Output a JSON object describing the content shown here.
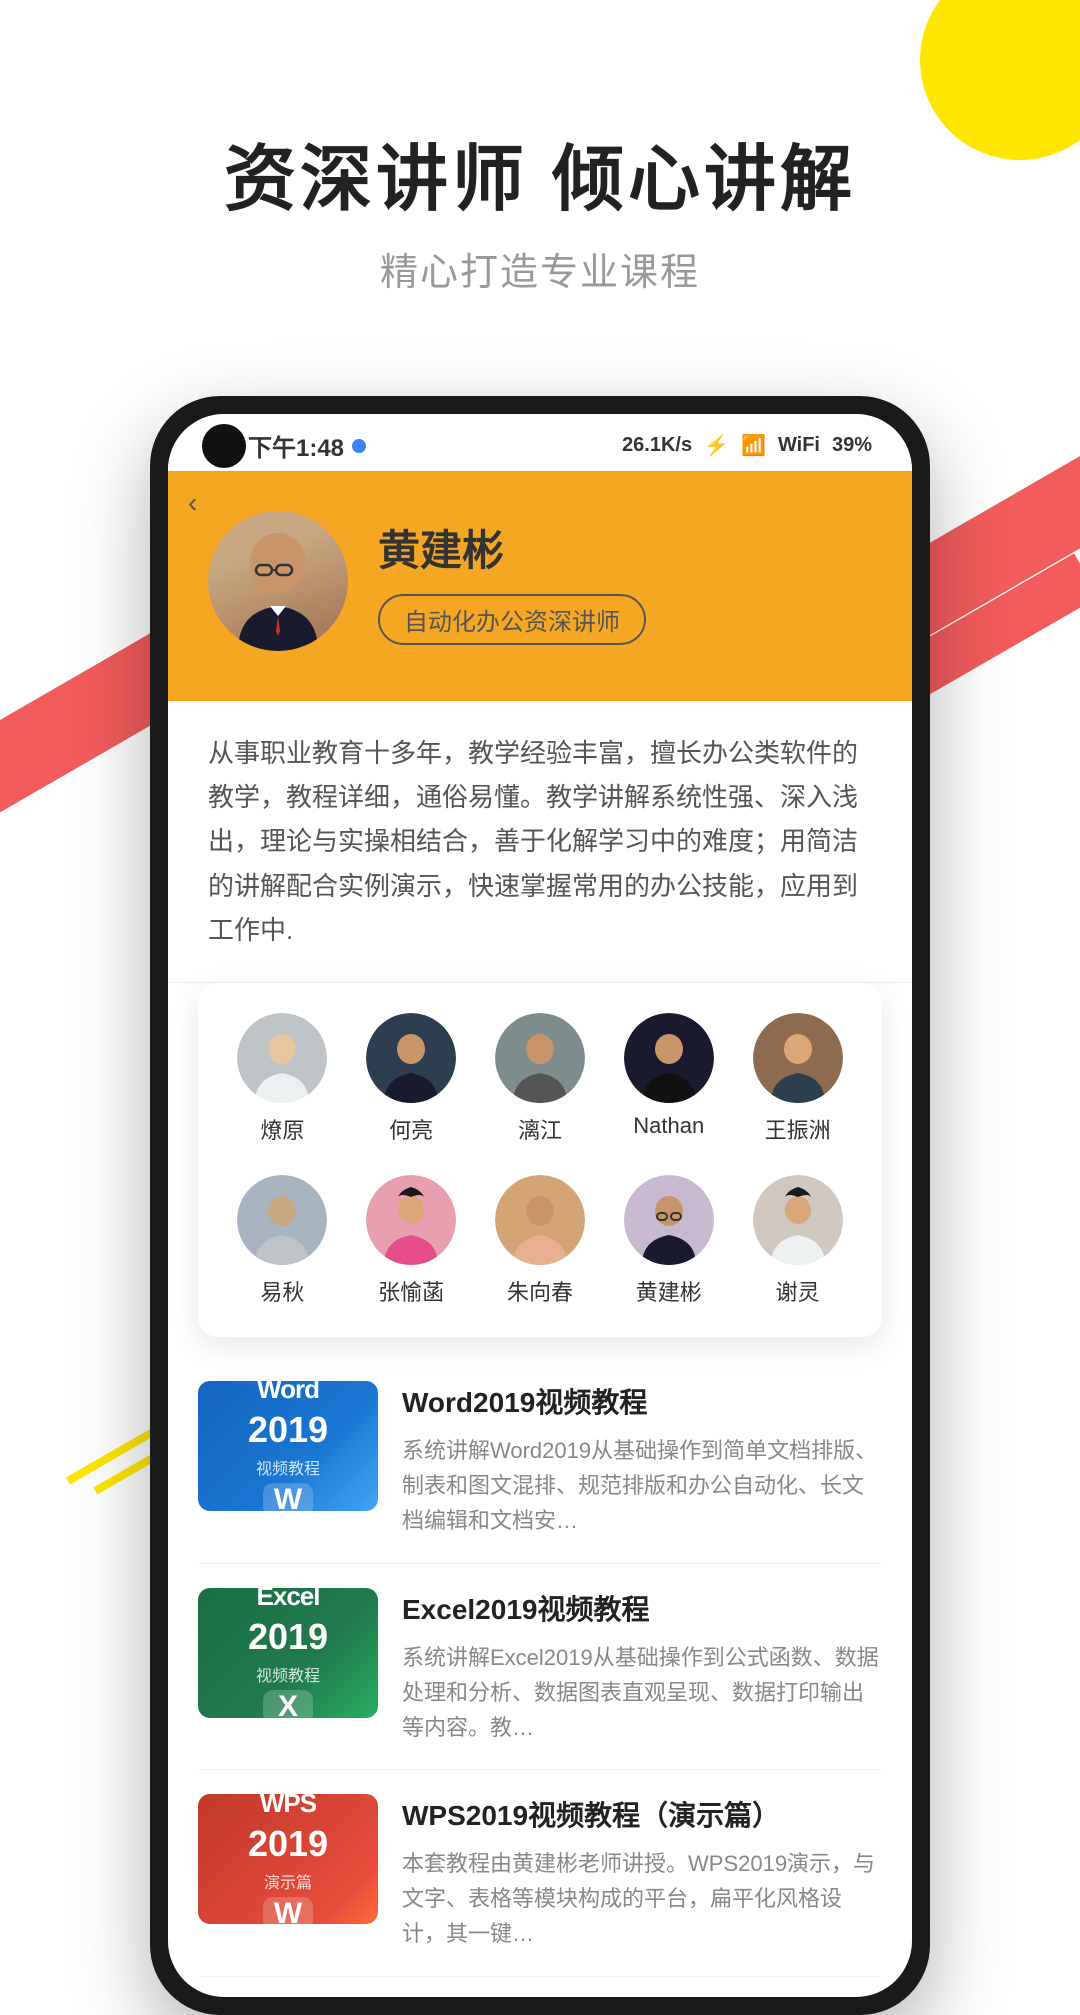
{
  "decorations": {
    "circle_color": "#FFE600",
    "stripe_color": "#F04040"
  },
  "header": {
    "title": "资深讲师  倾心讲解",
    "subtitle": "精心打造专业课程"
  },
  "phone": {
    "status": {
      "time": "下午1:48",
      "network_speed": "26.1K/s",
      "battery": "39%"
    },
    "instructor_profile": {
      "back_label": "‹",
      "name": "黄建彬",
      "badge": "自动化办公资深讲师",
      "bio": "从事职业教育十多年，教学经验丰富，擅长办公类软件的教学，教程详细，通俗易懂。教学讲解系统性强、深入浅出，理论与实操相结合，善于化解学习中的难度；用简洁的讲解配合实例演示，快速掌握常用的办公技能，应用到工作中."
    },
    "instructor_grid": {
      "row1": [
        {
          "name": "燎原",
          "avatar_class": "av-1"
        },
        {
          "name": "何亮",
          "avatar_class": "av-2"
        },
        {
          "name": "漓江",
          "avatar_class": "av-3"
        },
        {
          "name": "Nathan",
          "avatar_class": "av-4"
        },
        {
          "name": "王振洲",
          "avatar_class": "av-5"
        }
      ],
      "row2": [
        {
          "name": "易秋",
          "avatar_class": "av-6"
        },
        {
          "name": "张愉菡",
          "avatar_class": "av-7"
        },
        {
          "name": "朱向春",
          "avatar_class": "av-8"
        },
        {
          "name": "黄建彬",
          "avatar_class": "av-9"
        },
        {
          "name": "谢灵",
          "avatar_class": "av-10"
        }
      ]
    },
    "courses": [
      {
        "id": "word2019",
        "thumb_type": "word",
        "title": "Word2019视频教程",
        "desc": "系统讲解Word2019从基础操作到简单文档排版、制表和图文混排、规范排版和办公自动化、长文档编辑和文档安…",
        "thumb_label_big": "Word",
        "thumb_label_year": "2019",
        "thumb_label_sub": "视频教程",
        "word_letter": "W"
      },
      {
        "id": "excel2019",
        "thumb_type": "excel",
        "title": "Excel2019视频教程",
        "desc": "系统讲解Excel2019从基础操作到公式函数、数据处理和分析、数据图表直观呈现、数据打印输出等内容。教…",
        "thumb_label_big": "Excel",
        "thumb_label_year": "2019",
        "thumb_label_sub": "视频教程",
        "word_letter": "X"
      },
      {
        "id": "wps2019",
        "thumb_type": "wps",
        "title": "WPS2019视频教程（演示篇）",
        "desc": "本套教程由黄建彬老师讲授。WPS2019演示，与文字、表格等模块构成的平台，扁平化风格设计，其一键…",
        "thumb_label_big": "WPS",
        "thumb_label_year": "2019",
        "thumb_label_sub": "演示篇",
        "word_letter": "W"
      }
    ]
  }
}
